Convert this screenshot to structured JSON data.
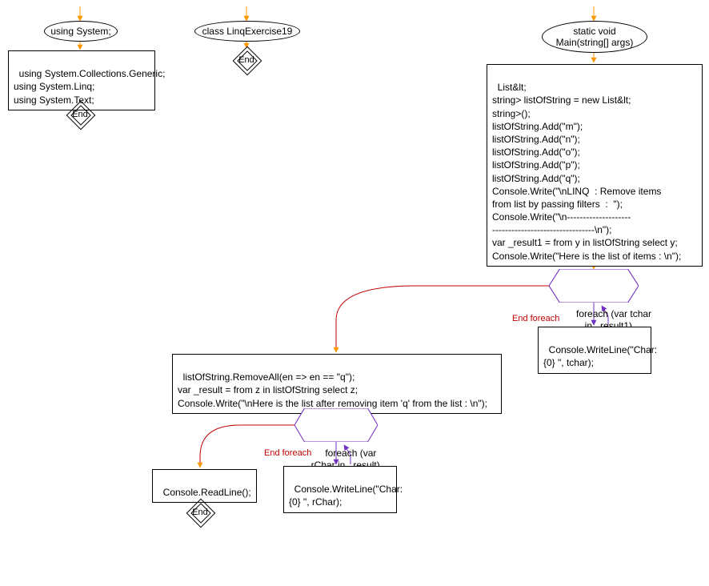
{
  "block1": {
    "ellipse": "using System;",
    "box": "using System.Collections.Generic;\nusing System.Linq;\nusing System.Text;",
    "end": "End"
  },
  "block2": {
    "ellipse": "class LinqExercise19",
    "end": "End"
  },
  "block3": {
    "ellipse": "static void\nMain(string[] args)",
    "box": "List&lt;\nstring> listOfString = new List&lt;\nstring>();\nlistOfString.Add(\"m\");\nlistOfString.Add(\"n\");\nlistOfString.Add(\"o\");\nlistOfString.Add(\"p\");\nlistOfString.Add(\"q\");\nConsole.Write(\"\\nLINQ  : Remove items\nfrom list by passing filters  :  \");\nConsole.Write(\"\\n--------------------\n--------------------------------\\n\");\nvar _result1 = from y in listOfString select y;\nConsole.Write(\"Here is the list of items : \\n\");"
  },
  "foreach1": {
    "head": "foreach (var tchar\nin _result1)",
    "body": "Console.WriteLine(\"Char:\n{0} \", tchar);",
    "endLabel": "End foreach"
  },
  "mid": {
    "box": "listOfString.RemoveAll(en => en == \"q\");\nvar _result = from z in listOfString select z;\nConsole.Write(\"\\nHere is the list after removing item 'q' from the list : \\n\");"
  },
  "foreach2": {
    "head": "foreach (var\nrChar in _result)",
    "body": "Console.WriteLine(\"Char:\n{0} \", rChar);",
    "endLabel": "End foreach"
  },
  "final": {
    "box": "Console.ReadLine();",
    "end": "End"
  }
}
